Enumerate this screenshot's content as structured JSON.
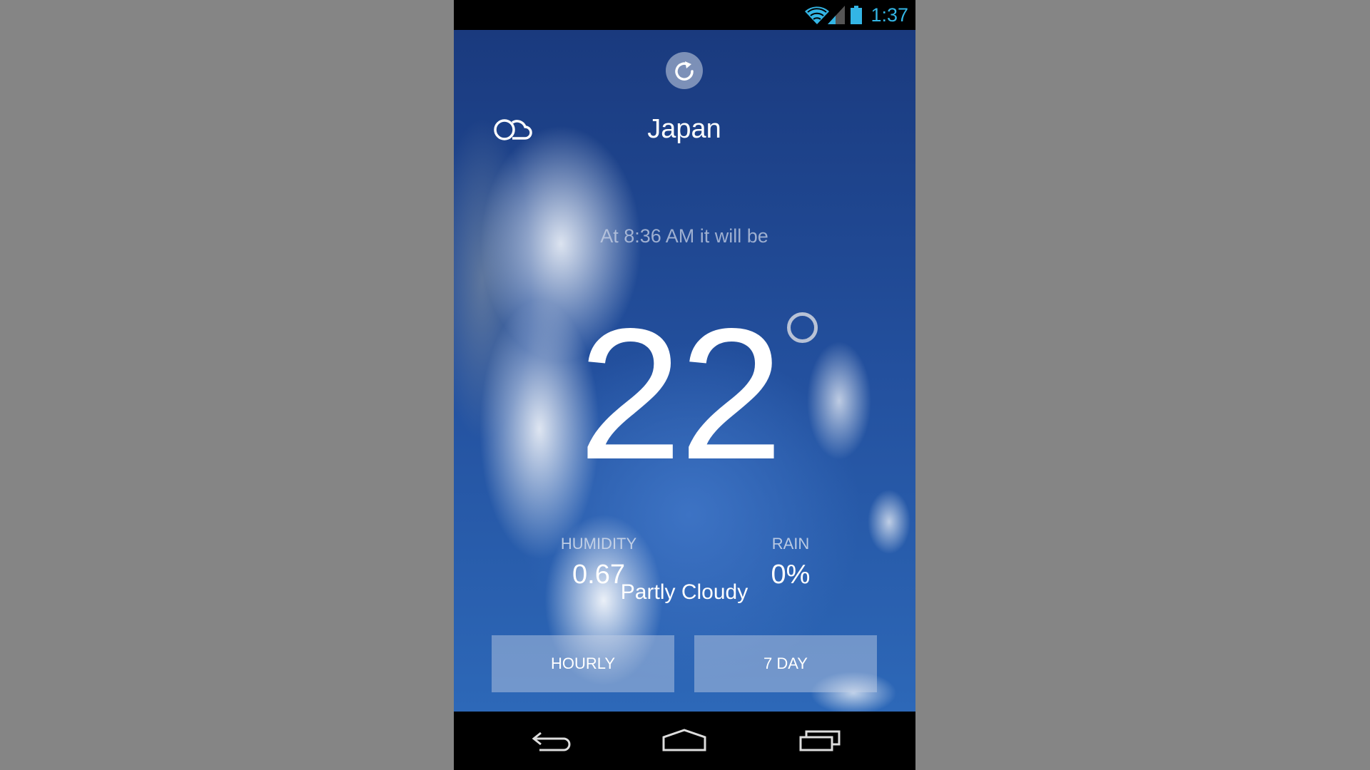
{
  "status_bar": {
    "time": "1:37",
    "icons": [
      "wifi-icon",
      "signal-icon",
      "battery-icon"
    ],
    "accent": "#33b5e5"
  },
  "header": {
    "city": "Japan",
    "refresh_icon": "refresh-icon",
    "weather_icon": "partly-cloudy-icon"
  },
  "forecast": {
    "intro": "At 8:36 AM it will be",
    "temperature": "22",
    "humidity_label": "HUMIDITY",
    "humidity_value": "0.67",
    "rain_label": "RAIN",
    "rain_value": "0%",
    "condition": "Partly Cloudy"
  },
  "buttons": {
    "hourly": "HOURLY",
    "seven_day": "7 DAY"
  },
  "navbar": {
    "icons": [
      "back-icon",
      "home-icon",
      "recents-icon"
    ]
  }
}
